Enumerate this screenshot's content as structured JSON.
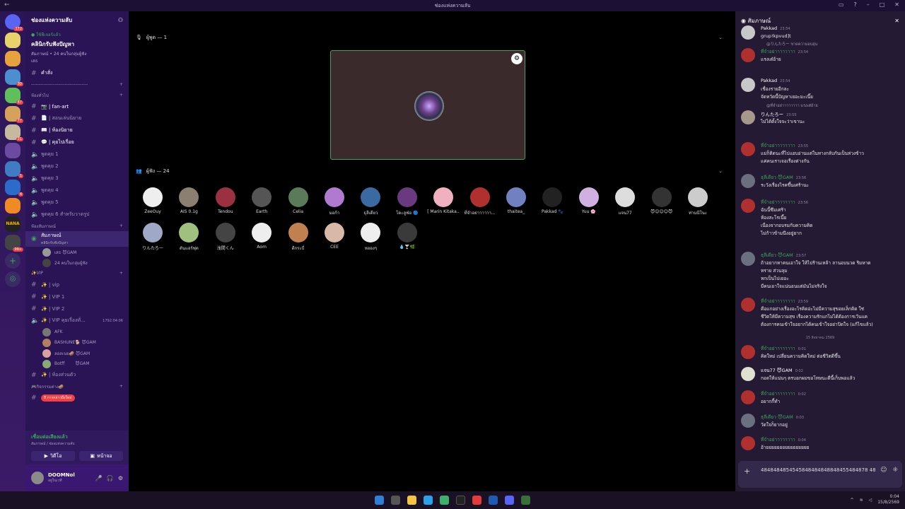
{
  "titlebar": {
    "title": "ช่องแห่งความลับ",
    "back": "←"
  },
  "guild_badges": [
    "172",
    "30",
    "47",
    "77",
    "21",
    "1",
    "4",
    "99+"
  ],
  "server": {
    "name": "ช่องแห่งความลับ"
  },
  "event": {
    "status": "● ใช้ฟีเจอร์แล้ว",
    "title": "คลินิกรับฟังปัญหา",
    "meta": "สัมภาษณ์ • 24 คนในกลุ่มผู้ฟัง",
    "host": "เสธ"
  },
  "channels": {
    "top": [
      {
        "name": "คำสั่ง"
      }
    ],
    "divider": "-------------------------------------",
    "cat_general": "ห้องทั่วไป",
    "general": [
      "📷 | fan-art",
      "📄 | สอนเล่นนิยาย",
      "📖 | ห้องนิยาย",
      "💬 | คุยไปเรื่อย"
    ],
    "voice": [
      "พูดคุย 1",
      "พูดคุย 2",
      "พูดคุย 3",
      "พูดคุย 4",
      "พูดคุย 5",
      "พูดคุย 6 สำหรับวาดรูป"
    ],
    "cat_stage": "ห้องสัมภาษณ์",
    "stage_name": "สัมภาษณ์",
    "stage_sub": "คลินิกรับฟังปัญหา",
    "stage_users": [
      "เสธ 😈GAM",
      "24 คนในกลุ่มผู้ฟัง"
    ],
    "cat_vip": "✨VIP",
    "vip": [
      "✨ | vip",
      "✨ | VIP 1",
      "✨ | VIP 2",
      "✨ | VIP คุยเรื่องทั่..."
    ],
    "vip_timer": "1792:04:06",
    "vip_users": [
      "AFK",
      "BASHUNE🐕 😈GAM",
      "ลอลเนย🥔 😈GAM",
      "Botff ⠀⠀⠀😈GAM"
    ],
    "private": "✨ | ห้องส่วนตัว",
    "cat_games": "🎮กิจกรรมต่าง🥔",
    "new_badge": "8 การกล่าวถึงใหม่"
  },
  "voicebar": {
    "status": "เชื่อมต่อเสียงแล้ว",
    "sub": "สัมภาษณ์ / ช่องแห่งความลับ",
    "video": "วิดีโอ",
    "screen": "หน้าจอ"
  },
  "user": {
    "name": "DOOMNol",
    "status": "อยู่ในเวที"
  },
  "main": {
    "speakers_label": "ผู้พูด — 1",
    "audience_label": "ผู้ฟัง — 24"
  },
  "audience": [
    "ZeeOuy",
    "AIS 0.1g",
    "Tendou",
    "Earth",
    "Celia",
    "มอก้า",
    "ธุลีเดียว",
    "โตะลูฟ่อ 🔵",
    "[ Marin Kitaka...",
    "ที่จำอย่าาาาาา...",
    "thaitea_",
    "Pakkad 🐾",
    "Yuu 🌸",
    "แจน77",
    "😈😊😊😊😈",
    "ท่านนีโนะ",
    "りんたろー",
    "ดันแอร์ฟุต",
    "浅間くん",
    "Aom",
    "ดีกระบี่",
    "CEE",
    "หอองๆ",
    "💧🍸🌿"
  ],
  "chat": {
    "title": "สัมภาษณ์",
    "messages": [
      {
        "name": "Pakkad",
        "time": "23:54",
        "lines": [
          "grup!kpvud]t"
        ]
      },
      {
        "reply": "@りんたろー ขาดความอบอุ่น",
        "name": "ที่จำอย่าาาาาาาา",
        "time": "23:54",
        "lines": [
          "แรงเต๋อ้าย"
        ]
      },
      {
        "name": "Pakkad",
        "time": "23:54",
        "lines": [
          "เชื่องรายอีกละ",
          "จัดหวัดนี้ปัญหาเยอะมะเนี๊ย"
        ]
      },
      {
        "reply": "@ที่จำอย่าาาาาาาา แรงเต๋อ้าย",
        "name": "りんたろー",
        "time": "23:55",
        "lines": [
          "ไม่ได้ตั้งใจจะว่าเขานะ"
        ]
      },
      {
        "name": "ที่จำอย่าาาาาาาา",
        "time": "23:55",
        "lines": [
          "แม่ก็ติดนะที่ไปแอบอ่านแต่ในทางกลับกันเป็นห่วงข้าว",
          "แค่คนเราเจอเรื่องต่างกัน"
        ]
      },
      {
        "name": "ธุลีเดียว 😈GAM",
        "time": "23:56",
        "lines": [
          "ระวังเรื่องไรคขึ้นเศร้านะ"
        ]
      },
      {
        "name": "ที่จำอย่าาาาาาาา",
        "time": "23:56",
        "lines": [
          "ฉันนี้ซึมเศร้า",
          "ห้องสะโรเนี๊ย",
          "เนื่องจากอบรมกับความคิด",
          "ไม่ก้าวข้ามนึงอยู่ยาก"
        ]
      },
      {
        "name": "ธุลีเดียว 😈GAM",
        "time": "23:57",
        "lines": [
          "ถ้าอยากหาคนเอาใจ ให้ไปร้านเหล้า ลานอบนวด ริมหาด",
          "ทราย ส่วนลุม",
          "หกเป็นไปเยอะ",
          "มีคนเอาใจแน่นอนแต่มันไม่จริงใจ"
        ]
      },
      {
        "name": "ที่จำอย่าาาาาาาา",
        "time": "23:59",
        "lines": [
          "คือแกอย่างเรื่องอะไรคิดอ่ะไม่มีความสุขอยเล็กคิด ใช่",
          "ชีวิตให้มีความสุข เรื่องความรักแกไม่ได้ต้องการเว้นแค",
          "ต้องการคนเข้าใจอยากได้คนเข้าใจอย่าปิดใจ (แก้ไขแล้ว)"
        ]
      },
      {
        "date": "15 สิงหาคม 2569"
      },
      {
        "name": "ที่จำอย่าาาาาาาา",
        "time": "0:01",
        "lines": [
          "คิดใหม่ เปลี่ยนความคิดใหม่ ต่อชีวิตดีขึ้น"
        ]
      },
      {
        "name": "แจน77 😈GAM",
        "time": "0:02",
        "lines": [
          "กอดให้แน่นๆ ตรบอกผมขอโทษนะดีนี้เก็บพอแล้ว"
        ]
      },
      {
        "name": "ที่จำอย่าาาาาาาา",
        "time": "0:02",
        "lines": [
          "อยากกี้ทำ"
        ]
      },
      {
        "name": "ธุลีเดียว 😈GAM",
        "time": "0:03",
        "lines": [
          "วัดใจก็ยากอยู่"
        ]
      },
      {
        "name": "ที่จำอย่าาาาาาาา",
        "time": "0:04",
        "lines": [
          "อ้ายยยยยยยยยยยยยยยย"
        ]
      }
    ],
    "input_value": "4848484854545848484848848455484878 48"
  },
  "clock": {
    "time": "0:04",
    "date": "15/8/2569"
  }
}
